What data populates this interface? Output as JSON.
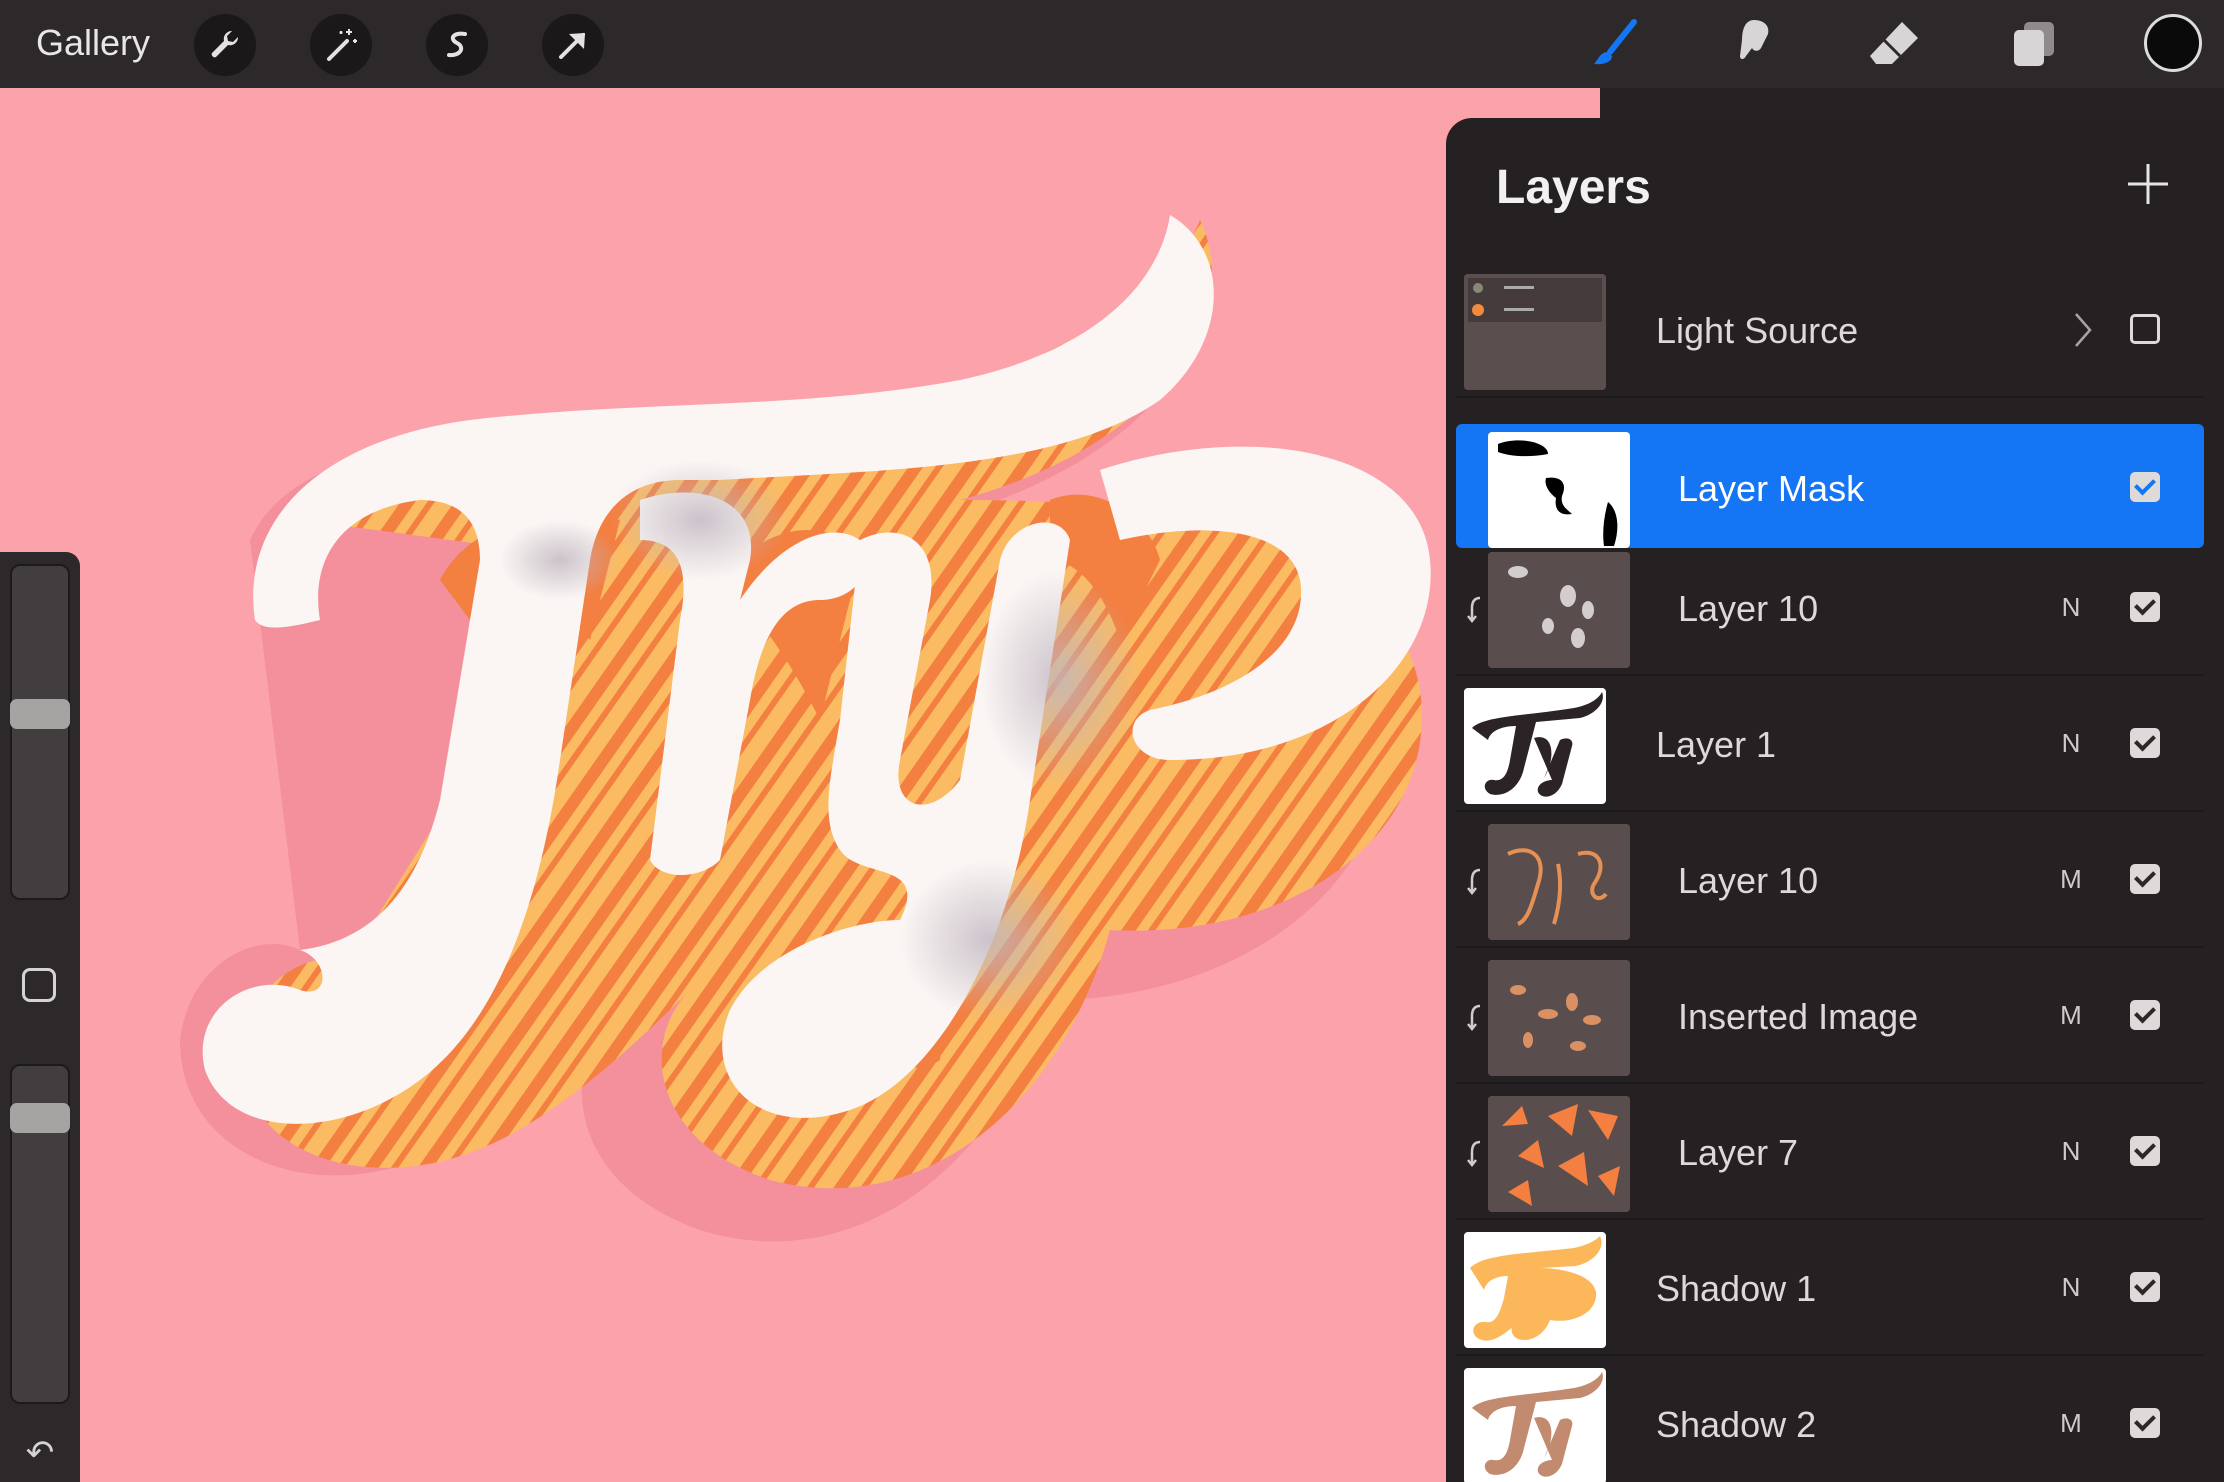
{
  "toolbar": {
    "gallery_label": "Gallery",
    "left_tools": [
      "wrench-icon",
      "magic-wand-icon",
      "selection-s-icon",
      "transform-arrow-icon"
    ],
    "right_tools": [
      "brush-icon",
      "smudge-icon",
      "eraser-icon",
      "layers-icon"
    ],
    "active_tool": "brush-icon",
    "active_color": "#0a0a0a",
    "accent": "#1476f4"
  },
  "canvas": {
    "background": "#fca2ab",
    "artwork_text": "Try"
  },
  "sidebar": {
    "brush_size_level": 0.58,
    "opacity_level": 0.88,
    "modify_icon": "square-icon",
    "undo_icon": "undo-arrow-icon"
  },
  "layers": {
    "title": "Layers",
    "add_icon": "plus-icon",
    "items": [
      {
        "name": "Light Source",
        "mode": "",
        "visible": false,
        "group": true,
        "clipped": false,
        "selected": false
      },
      {
        "name": "Layer Mask",
        "mode": "",
        "visible": true,
        "group": false,
        "clipped": false,
        "selected": true
      },
      {
        "name": "Layer 10",
        "mode": "N",
        "visible": true,
        "group": false,
        "clipped": true,
        "selected": false
      },
      {
        "name": "Layer 1",
        "mode": "N",
        "visible": true,
        "group": false,
        "clipped": false,
        "selected": false
      },
      {
        "name": "Layer 10",
        "mode": "M",
        "visible": true,
        "group": false,
        "clipped": true,
        "selected": false
      },
      {
        "name": "Inserted Image",
        "mode": "M",
        "visible": true,
        "group": false,
        "clipped": true,
        "selected": false
      },
      {
        "name": "Layer 7",
        "mode": "N",
        "visible": true,
        "group": false,
        "clipped": true,
        "selected": false
      },
      {
        "name": "Shadow 1",
        "mode": "N",
        "visible": true,
        "group": false,
        "clipped": false,
        "selected": false
      },
      {
        "name": "Shadow 2",
        "mode": "M",
        "visible": true,
        "group": false,
        "clipped": false,
        "selected": false
      }
    ]
  }
}
